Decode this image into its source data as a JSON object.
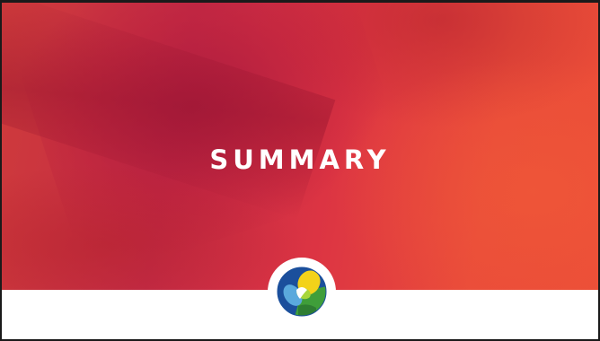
{
  "slide": {
    "title": "SUMMARY"
  },
  "logo": {
    "icon": "tricolor-circle-logo",
    "colors": [
      "#1b4f9c",
      "#5aa9dd",
      "#f3d21a",
      "#4caf3a",
      "#2e7d32"
    ]
  },
  "colors": {
    "background": "#ffffff",
    "accent_red": "#e0383f",
    "accent_crimson": "#b81e44",
    "accent_orange": "#ec4e38",
    "border": "#1a1a1a"
  }
}
